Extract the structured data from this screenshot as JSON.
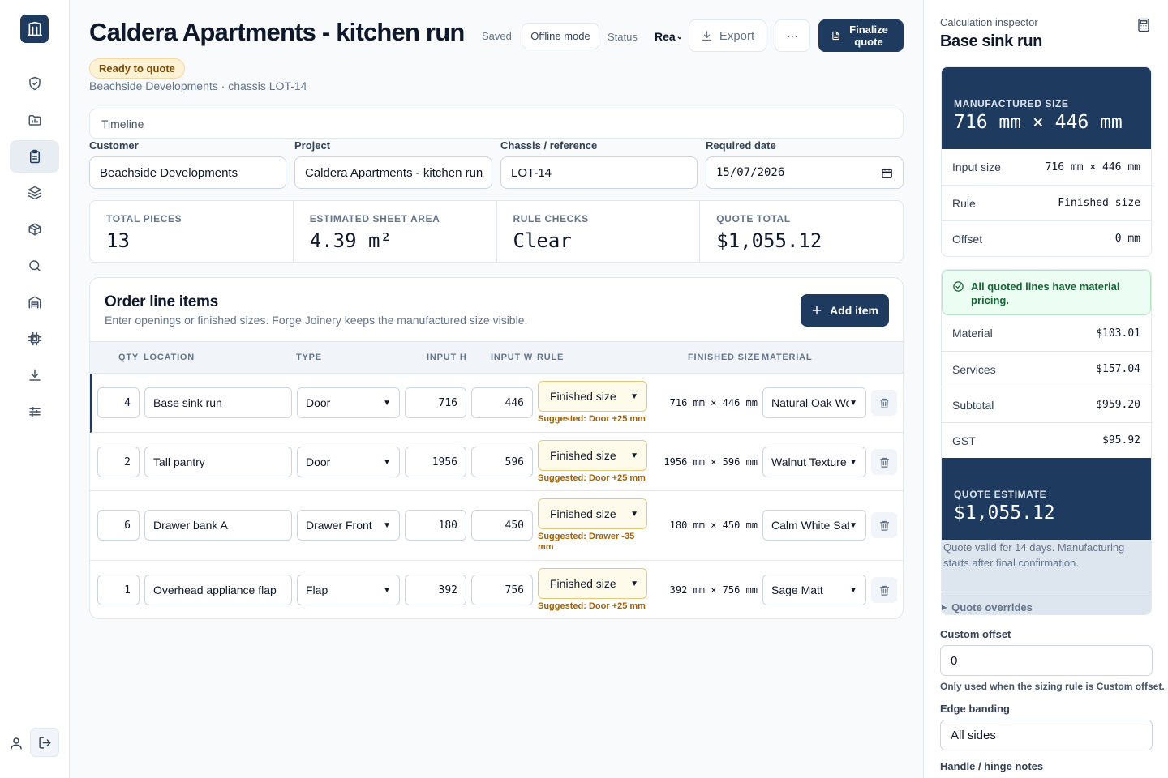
{
  "sidebar": {
    "logo_icon": "building-icon",
    "items": [
      {
        "icon": "shield-icon"
      },
      {
        "icon": "folder-icon"
      },
      {
        "icon": "clipboard-icon",
        "active": true
      },
      {
        "icon": "layers-icon"
      },
      {
        "icon": "package-icon"
      },
      {
        "icon": "search-icon"
      },
      {
        "icon": "warehouse-icon"
      },
      {
        "icon": "cpu-icon"
      },
      {
        "icon": "download-icon"
      },
      {
        "icon": "sliders-icon"
      }
    ],
    "user_icon": "user-icon",
    "logout_icon": "logout-icon"
  },
  "header": {
    "title": "Caldera Apartments - kitchen run",
    "saved": "Saved",
    "offline_mode": "Offline mode",
    "status_label": "Status",
    "status_value": "Rea",
    "export": "Export",
    "more": "···",
    "finalize": "Finalize quote",
    "badge": "Ready to quote",
    "subline": "Beachside Developments · chassis LOT-14"
  },
  "timeline": "Timeline",
  "fields": {
    "customer": {
      "label": "Customer",
      "value": "Beachside Developments"
    },
    "project": {
      "label": "Project",
      "value": "Caldera Apartments - kitchen run"
    },
    "chassis": {
      "label": "Chassis / reference",
      "value": "LOT-14"
    },
    "date": {
      "label": "Required date",
      "value": "15/07/2026"
    }
  },
  "stats": [
    {
      "label": "TOTAL PIECES",
      "value": "13"
    },
    {
      "label": "ESTIMATED SHEET AREA",
      "value": "4.39 m²"
    },
    {
      "label": "RULE CHECKS",
      "value": "Clear"
    },
    {
      "label": "QUOTE TOTAL",
      "value": "$1,055.12"
    }
  ],
  "order": {
    "title": "Order line items",
    "subtitle": "Enter openings or finished sizes. Forge Joinery keeps the manufactured size visible.",
    "add_item": "Add item",
    "columns": {
      "qty": "QTY",
      "location": "LOCATION",
      "type": "TYPE",
      "input_h": "INPUT H",
      "input_w": "INPUT W",
      "rule": "RULE",
      "finished": "FINISHED SIZE",
      "material": "MATERIAL"
    },
    "rows": [
      {
        "qty": "4",
        "location": "Base sink run",
        "type": "Door",
        "h": "716",
        "w": "446",
        "rule": "Finished size",
        "suggested": "Suggested: Door +25 mm",
        "finished": "716 mm × 446 mm",
        "material": "Natural Oak Woodmatt"
      },
      {
        "qty": "2",
        "location": "Tall pantry",
        "type": "Door",
        "h": "1956",
        "w": "596",
        "rule": "Finished size",
        "suggested": "Suggested: Door +25 mm",
        "finished": "1956 mm × 596 mm",
        "material": "Walnut Texture"
      },
      {
        "qty": "6",
        "location": "Drawer bank A",
        "type": "Drawer Front",
        "h": "180",
        "w": "450",
        "rule": "Finished size",
        "suggested": "Suggested: Drawer -35 mm",
        "finished": "180 mm × 450 mm",
        "material": "Calm White Satin"
      },
      {
        "qty": "1",
        "location": "Overhead appliance flap",
        "type": "Flap",
        "h": "392",
        "w": "756",
        "rule": "Finished size",
        "suggested": "Suggested: Door +25 mm",
        "finished": "392 mm × 756 mm",
        "material": "Sage Matt"
      }
    ]
  },
  "inspector": {
    "label": "Calculation inspector",
    "title": "Base sink run",
    "manufactured_label": "MANUFACTURED SIZE",
    "manufactured_value": "716 mm × 446 mm",
    "rows": [
      {
        "k": "Input size",
        "v": "716 mm × 446 mm"
      },
      {
        "k": "Rule",
        "v": "Finished size"
      },
      {
        "k": "Offset",
        "v": "0 mm"
      }
    ],
    "pricing_note": "All quoted lines have material pricing.",
    "costs": [
      {
        "k": "Material",
        "v": "$103.01"
      },
      {
        "k": "Services",
        "v": "$157.04"
      },
      {
        "k": "Subtotal",
        "v": "$959.20"
      },
      {
        "k": "GST",
        "v": "$95.92"
      }
    ],
    "estimate_label": "QUOTE ESTIMATE",
    "estimate_value": "$1,055.12",
    "validity": "Quote valid for 14 days. Manufacturing starts after final confirmation.",
    "overrides": "Quote overrides",
    "custom_offset_label": "Custom offset",
    "custom_offset_value": "0",
    "custom_offset_help": "Only used when the sizing rule is Custom offset.",
    "edge_label": "Edge banding",
    "edge_value": "All sides",
    "handle_label": "Handle / hinge notes"
  },
  "colors": {
    "accent": "#1e3a5f",
    "badge_bg": "#fdf1d6",
    "success_bg": "#ecfdf3",
    "warning_text": "#a16207"
  }
}
